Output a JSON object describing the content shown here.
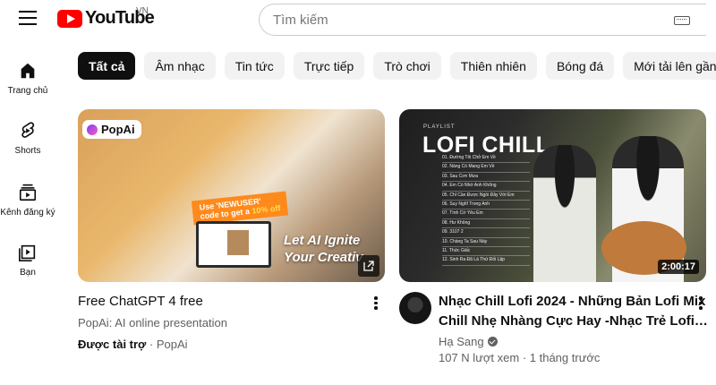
{
  "header": {
    "logo_text": "YouTube",
    "region": "VN",
    "search_placeholder": "Tìm kiếm"
  },
  "sidebar": {
    "items": [
      {
        "label": "Trang chủ",
        "icon": "home-icon"
      },
      {
        "label": "Shorts",
        "icon": "shorts-icon"
      },
      {
        "label": "Kênh đăng ký",
        "icon": "subscriptions-icon"
      },
      {
        "label": "Bạn",
        "icon": "you-icon"
      }
    ]
  },
  "chips": [
    "Tất cả",
    "Âm nhạc",
    "Tin tức",
    "Trực tiếp",
    "Trò chơi",
    "Thiên nhiên",
    "Bóng đá",
    "Mới tải lên gần đây"
  ],
  "videos": [
    {
      "title": "Free ChatGPT 4 free",
      "channel": "PopAi: AI online presentation",
      "sponsored_label": "Được tài trợ",
      "sponsor_name": "PopAi",
      "thumb": {
        "badge": "PopAi",
        "promo_line1": "Use 'NEWUSER'",
        "promo_line2": "code to get a",
        "promo_discount": "10% off",
        "headline_line1": "Let AI Ignite",
        "headline_line2": "Your Creativ"
      }
    },
    {
      "title_line1": "Nhạc Chill Lofi 2024 - Những Bản Lofi Mix",
      "title_line2": "Chill Nhẹ Nhàng Cực Hay -Nhạc Trẻ Lofi…",
      "channel": "Hạ Sang",
      "views": "107 N lượt xem",
      "age": "1 tháng trước",
      "duration": "2:00:17",
      "thumb": {
        "tag": "PLAYLIST",
        "title": "LOFI CHILL",
        "tracks": [
          "01. Đường Tôi Chở Em Về",
          "02. Nàng Có Mang Em Về",
          "03. Sau Cơn Mưa",
          "04. Em Có Nhớ Anh Không",
          "05. Chỉ Cần Được Ngồi Đây Với Em",
          "06. Suy Nghĩ Trong Anh",
          "07. Tình Cờ Yêu Em",
          "08. Hư Không",
          "09. 3107 2",
          "10. Chàng Ta Sau Này",
          "11. Thức Giấc",
          "12. Sinh Ra Đã Là Thứ Đối Lập"
        ]
      }
    }
  ],
  "colors": {
    "brand": "#ff0000",
    "chip_active": "#0f0f0f",
    "chip_bg": "#f2f2f2",
    "secondary_text": "#606060"
  }
}
